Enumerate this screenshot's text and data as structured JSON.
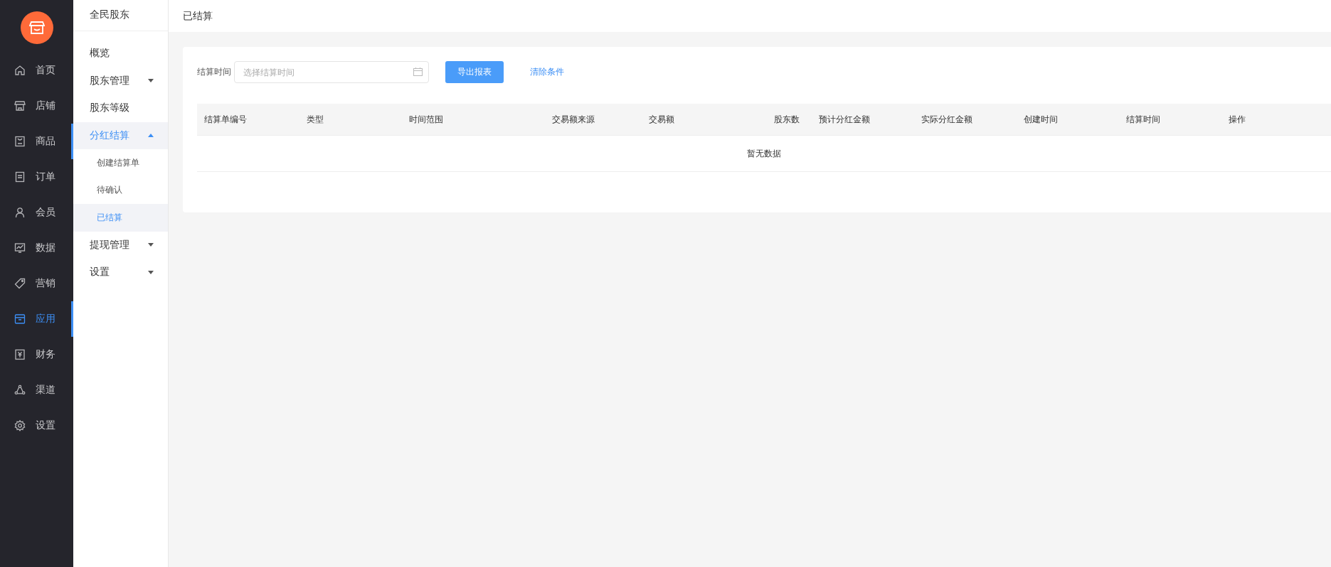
{
  "main_nav": [
    {
      "label": "首页",
      "selected": false,
      "indicator": false
    },
    {
      "label": "店铺",
      "selected": false,
      "indicator": false
    },
    {
      "label": "商品",
      "selected": false,
      "indicator": true
    },
    {
      "label": "订单",
      "selected": false,
      "indicator": false
    },
    {
      "label": "会员",
      "selected": false,
      "indicator": false
    },
    {
      "label": "数据",
      "selected": false,
      "indicator": false
    },
    {
      "label": "营销",
      "selected": false,
      "indicator": false
    },
    {
      "label": "应用",
      "selected": true,
      "indicator": true
    },
    {
      "label": "财务",
      "selected": false,
      "indicator": false
    },
    {
      "label": "渠道",
      "selected": false,
      "indicator": false
    },
    {
      "label": "设置",
      "selected": false,
      "indicator": false
    }
  ],
  "sub_nav": {
    "title": "全民股东",
    "items": [
      {
        "label": "概览",
        "selected": false
      },
      {
        "label": "股东管理",
        "selected": false,
        "expanded": false
      },
      {
        "label": "股东等级",
        "selected": false
      },
      {
        "label": "分红结算",
        "selected": true,
        "expanded": true,
        "children": [
          {
            "label": "创建结算单",
            "selected": false
          },
          {
            "label": "待确认",
            "selected": false
          },
          {
            "label": "已结算",
            "selected": true
          }
        ]
      },
      {
        "label": "提现管理",
        "selected": false,
        "expanded": false
      },
      {
        "label": "设置",
        "selected": false,
        "expanded": false
      }
    ]
  },
  "page_title": "已结算",
  "filter": {
    "label": "结算时间",
    "placeholder": "选择结算时间",
    "export_button": "导出报表",
    "clear_link": "清除条件"
  },
  "table": {
    "columns": [
      {
        "label": "结算单编号"
      },
      {
        "label": "类型"
      },
      {
        "label": "时间范围"
      },
      {
        "label": "交易额来源"
      },
      {
        "label": "交易额"
      },
      {
        "label": "股东数"
      },
      {
        "label": "预计分红金额"
      },
      {
        "label": "实际分红金额"
      },
      {
        "label": "创建时间"
      },
      {
        "label": "结算时间"
      },
      {
        "label": "操作"
      }
    ],
    "empty_text": "暂无数据"
  }
}
